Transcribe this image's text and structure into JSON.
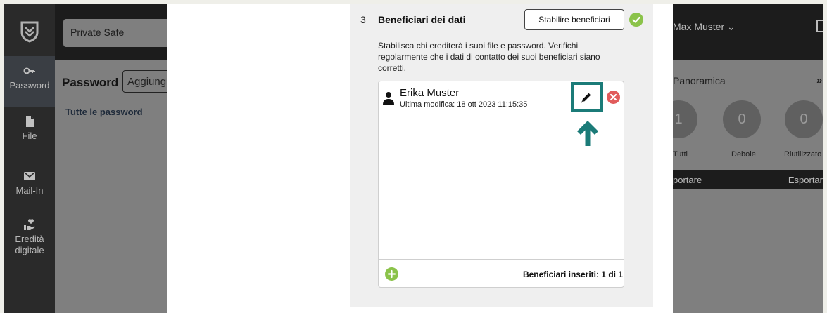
{
  "app": {
    "safe_selector": "Private Safe",
    "user_menu": "Max Muster ⌄"
  },
  "sidebar": {
    "items": [
      {
        "id": "password",
        "label": "Password",
        "icon": "key-icon"
      },
      {
        "id": "file",
        "label": "File",
        "icon": "file-icon"
      },
      {
        "id": "mail_in",
        "label": "Mail-In",
        "icon": "mail-icon"
      },
      {
        "id": "inheritance",
        "label": "Eredità digitale",
        "icon": "heart-hand-icon"
      }
    ]
  },
  "main": {
    "title": "Password",
    "add_button": "Aggiung",
    "all_passwords": "Tutte le password",
    "overview": {
      "title": "Panoramica",
      "expand": "»",
      "stats": [
        {
          "label": "Tutti",
          "value": "1"
        },
        {
          "label": "Debole",
          "value": "0"
        },
        {
          "label": "Riutilizzato",
          "value": "0"
        }
      ],
      "export_left": "portare",
      "export_right": "Esportar"
    }
  },
  "modal": {
    "step_number": "3",
    "section_title": "Beneficiari dei dati",
    "set_beneficiaries_button": "Stabilire beneficiari",
    "description": "Stabilisca chi erediterà i suoi file e password. Verifichi regolarmente che i dati di contatto dei suoi beneficiari siano corretti.",
    "beneficiary": {
      "name": "Erika Muster",
      "modified": "Ultima modifica: 18 ott 2023 11:15:35"
    },
    "count_label": "Beneficiari inseriti: 1 di 1"
  },
  "colors": {
    "highlight": "#1b7b78",
    "success": "#8bc34a",
    "danger": "#e15b5b"
  }
}
